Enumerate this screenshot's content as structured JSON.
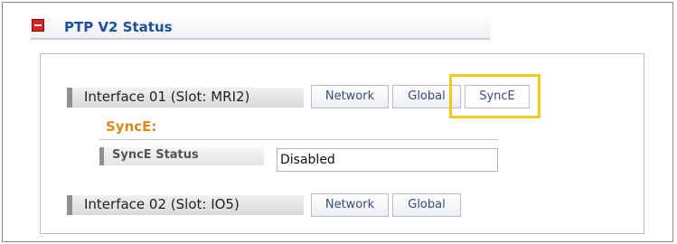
{
  "header": {
    "title": "PTP V2 Status",
    "collapse_icon": "collapse-minus-icon"
  },
  "interfaces": [
    {
      "label": "Interface 01 (Slot: MRI2)",
      "tabs": [
        "Network",
        "Global",
        "SyncE"
      ],
      "active_tab": "SyncE"
    },
    {
      "label": "Interface 02 (Slot: IO5)",
      "tabs": [
        "Network",
        "Global"
      ]
    }
  ],
  "synce_section": {
    "heading": "SyncE:",
    "status_label": "SyncE Status",
    "status_value": "Disabled"
  },
  "colors": {
    "title": "#1f4f9c",
    "synce_heading": "#d98a1a",
    "highlight": "#f2cc1a",
    "collapse_icon": "#e0201b"
  }
}
